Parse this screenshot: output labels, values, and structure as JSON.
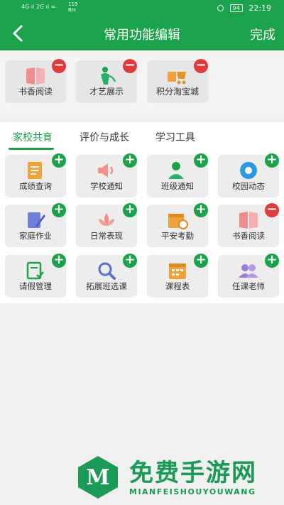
{
  "status": {
    "left_signal": "4G ıl  2G ıl  ≈",
    "speed_num": "119",
    "speed_unit": "B/s",
    "battery": "94",
    "time": "22:19"
  },
  "nav": {
    "title": "常用功能编辑",
    "done": "完成"
  },
  "selected": [
    {
      "label": "书香阅读",
      "icon": "book-icon"
    },
    {
      "label": "才艺展示",
      "icon": "talent-person-icon"
    },
    {
      "label": "积分淘宝城",
      "icon": "points-cart-icon"
    }
  ],
  "tabs": [
    "家校共育",
    "评价与成长",
    "学习工具"
  ],
  "active_tab": 0,
  "grid": [
    {
      "label": "成绩查询",
      "icon": "grades-doc-icon",
      "action": "+"
    },
    {
      "label": "学校通知",
      "icon": "speaker-icon",
      "action": "+"
    },
    {
      "label": "班级通知",
      "icon": "person-bell-icon",
      "action": "+"
    },
    {
      "label": "校园动态",
      "icon": "camera-aperture-icon",
      "action": "+"
    },
    {
      "label": "家庭作业",
      "icon": "homework-pencil-icon",
      "action": "+"
    },
    {
      "label": "日常表现",
      "icon": "lotus-icon",
      "action": "+"
    },
    {
      "label": "平安考勤",
      "icon": "calendar-clock-icon",
      "action": "+"
    },
    {
      "label": "书香阅读",
      "icon": "book-icon",
      "action": "−"
    },
    {
      "label": "请假管理",
      "icon": "leave-doc-icon",
      "action": "+"
    },
    {
      "label": "拓展班选课",
      "icon": "magnifier-icon",
      "action": "+"
    },
    {
      "label": "课程表",
      "icon": "calendar-grid-icon",
      "action": "+"
    },
    {
      "label": "任课老师",
      "icon": "teachers-icon",
      "action": "+"
    }
  ],
  "watermark": {
    "title": "免费手游网",
    "subtitle": "MIANFEISHOUYOUWANG"
  },
  "colors": {
    "primary": "#1aa34a",
    "minus_badge": "#e23a3a",
    "tile_bg": "#ededed"
  }
}
